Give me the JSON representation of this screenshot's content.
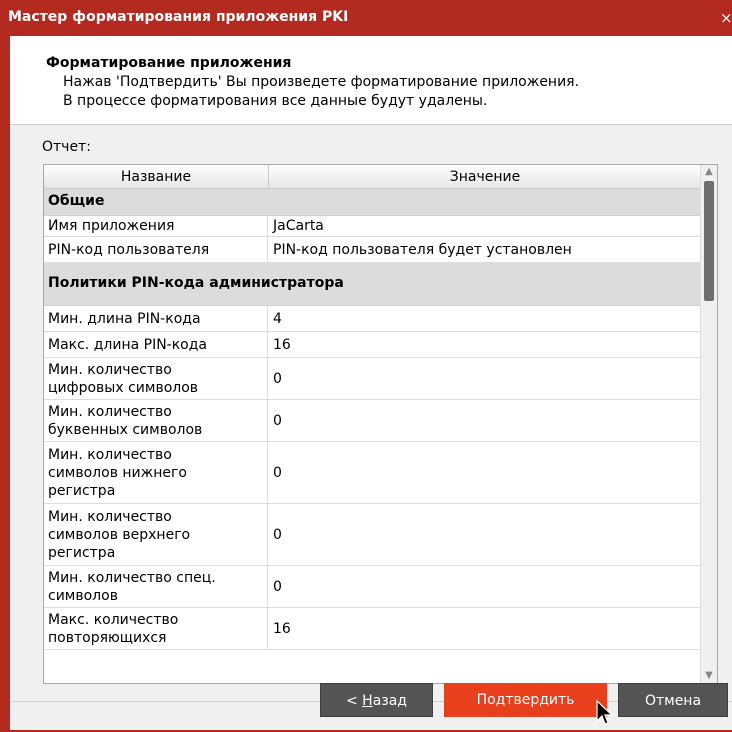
{
  "window": {
    "title": "Мастер форматирования приложения PKI",
    "close_glyph": "×"
  },
  "header": {
    "title": "Форматирование приложения",
    "line1": "Нажав 'Подтвердить' Вы произведете форматирование приложения.",
    "line2": "В процессе форматирования все данные будут удалены."
  },
  "report": {
    "label": "Отчет:",
    "columns": [
      "Название",
      "Значение"
    ],
    "sections": [
      {
        "title": "Общие",
        "rows": [
          {
            "name": "Имя приложения",
            "value": "JaCarta"
          },
          {
            "name": "PIN-код пользователя",
            "value": "PIN-код пользователя будет установлен"
          }
        ]
      },
      {
        "title": "Политики PIN-кода администратора",
        "rows": [
          {
            "name": "Мин. длина PIN-кода",
            "value": "4"
          },
          {
            "name": "Макс. длина PIN-кода",
            "value": "16"
          },
          {
            "name": "Мин. количество\nцифровых символов",
            "value": "0"
          },
          {
            "name": "Мин. количество\nбуквенных символов",
            "value": "0"
          },
          {
            "name": "Мин. количество\nсимволов нижнего\nрегистра",
            "value": "0"
          },
          {
            "name": "Мин. количество\nсимволов верхнего\nрегистра",
            "value": "0"
          },
          {
            "name": "Мин. количество спец.\nсимволов",
            "value": "0"
          },
          {
            "name": "Макс. количество\nповторяющихся",
            "value": "16"
          }
        ]
      }
    ]
  },
  "buttons": {
    "back_prefix": "< ",
    "back_underlined": "Н",
    "back_rest": "азад",
    "confirm": "Подтвердить",
    "cancel": "Отмена"
  },
  "scrollbar": {
    "up_glyph": "▲",
    "down_glyph": "▼"
  },
  "colors": {
    "title_bar": "#b32a20",
    "confirm_button": "#e8401c",
    "secondary_button": "#545454"
  }
}
